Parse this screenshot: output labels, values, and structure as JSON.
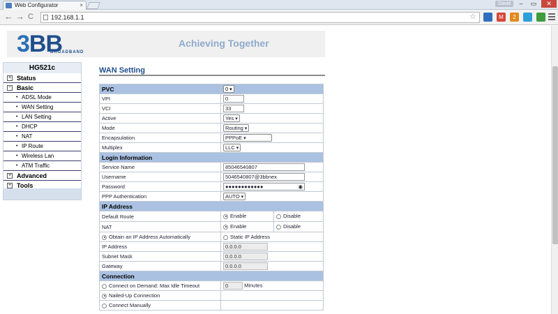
{
  "browser": {
    "tab_title": "Web Configurator",
    "tab_close": "×",
    "user_badge": "David",
    "win_min": "–",
    "win_max": "▭",
    "win_close": "✕",
    "back": "←",
    "forward": "→",
    "reload": "C",
    "url": "192.168.1.1",
    "star": "☆",
    "extensions": [
      {
        "name": "ext-1",
        "color": "#2f6fbd",
        "text": ""
      },
      {
        "name": "gmail-icon",
        "color": "#d44638",
        "text": "M"
      },
      {
        "name": "ext-3",
        "color": "#e08a1e",
        "text": "2"
      },
      {
        "name": "ext-4",
        "color": "#2d9fd9",
        "text": ""
      },
      {
        "name": "ext-5",
        "color": "#3e9b3e",
        "text": ""
      }
    ]
  },
  "banner": {
    "logo_num": "3",
    "logo_letters": "BB",
    "logo_sub": "BROADBAND",
    "slogan": "Achieving Together"
  },
  "sidebar": {
    "model": "HG521c",
    "items": [
      {
        "type": "top",
        "sign": "+",
        "label": "Status"
      },
      {
        "type": "top",
        "sign": "−",
        "label": "Basic"
      },
      {
        "type": "sub",
        "label": "ADSL Mode"
      },
      {
        "type": "sub",
        "label": "WAN Setting"
      },
      {
        "type": "sub",
        "label": "LAN Setting"
      },
      {
        "type": "sub",
        "label": "DHCP"
      },
      {
        "type": "sub",
        "label": "NAT"
      },
      {
        "type": "sub",
        "label": "IP Route"
      },
      {
        "type": "sub",
        "label": "Wireless Lan"
      },
      {
        "type": "sub",
        "label": "ATM Traffic"
      },
      {
        "type": "top",
        "sign": "+",
        "label": "Advanced"
      },
      {
        "type": "top",
        "sign": "+",
        "label": "Tools"
      }
    ]
  },
  "page_title": "WAN Setting",
  "form": {
    "pvc": {
      "label": "PVC",
      "value": "0"
    },
    "vpi": {
      "label": "VPI",
      "value": "0"
    },
    "vci": {
      "label": "VCI",
      "value": "33"
    },
    "active": {
      "label": "Active",
      "value": "Yes"
    },
    "mode": {
      "label": "Mode",
      "value": "Routing"
    },
    "encapsulation": {
      "label": "Encapsulation",
      "value": "PPPoE"
    },
    "multiplex": {
      "label": "Multiplex",
      "value": "LLC"
    },
    "login_header": "Login Information",
    "service_name": {
      "label": "Service Name",
      "value": "85046540807"
    },
    "username": {
      "label": "Username",
      "value": "5046540807@3bbnex"
    },
    "password": {
      "label": "Password",
      "value": "●●●●●●●●●●●●"
    },
    "ppp_auth": {
      "label": "PPP Authentication",
      "value": "AUTO"
    },
    "ip_header": "IP Address",
    "default_route": {
      "label": "Default Route",
      "enable": "Enable",
      "disable": "Disable"
    },
    "nat": {
      "label": "NAT",
      "enable": "Enable",
      "disable": "Disable"
    },
    "obtain_auto": "Obtain an IP Address Automatically",
    "static_ip": "Static IP Address",
    "ip_address": {
      "label": "IP Address",
      "value": "0.0.0.0"
    },
    "subnet_mask": {
      "label": "Subnet Mask",
      "value": "0.0.0.0"
    },
    "gateway": {
      "label": "Gateway",
      "value": "0.0.0.0"
    },
    "connection_header": "Connection",
    "on_demand": "Connect on Demand: Max Idle Timeout",
    "idle_timeout": "0",
    "minutes": "Minutes",
    "nailed_up": "Nailed-Up Connection",
    "manual": "Connect Manually"
  }
}
